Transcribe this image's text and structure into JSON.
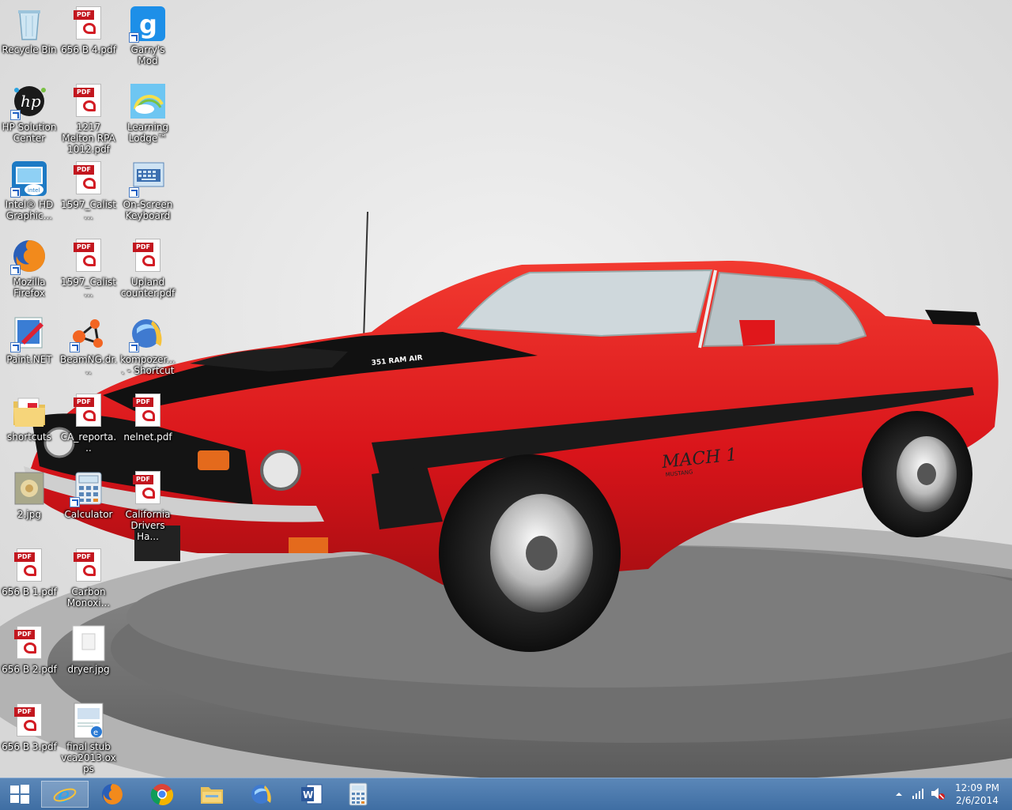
{
  "desktop": {
    "icons": [
      {
        "label": "Recycle Bin",
        "type": "recycle"
      },
      {
        "label": "656 B 4.pdf",
        "type": "pdf"
      },
      {
        "label": "Garry's Mod",
        "type": "app"
      },
      {
        "label": "HP Solution Center",
        "type": "app"
      },
      {
        "label": "1217 Melton RPA 1012.pdf",
        "type": "pdf"
      },
      {
        "label": "Learning Lodge™",
        "type": "app"
      },
      {
        "label": "Intel® HD Graphic...",
        "type": "app"
      },
      {
        "label": "1597_Calist...",
        "type": "pdf"
      },
      {
        "label": "On-Screen Keyboard",
        "type": "app"
      },
      {
        "label": "Mozilla Firefox",
        "type": "app"
      },
      {
        "label": "1597_Calist...",
        "type": "pdf"
      },
      {
        "label": "Upland counter.pdf",
        "type": "pdf"
      },
      {
        "label": "Paint.NET",
        "type": "app"
      },
      {
        "label": "BeamNG.dr...",
        "type": "app"
      },
      {
        "label": "kompozer.... - Shortcut",
        "type": "app"
      },
      {
        "label": "shortcuts",
        "type": "folder"
      },
      {
        "label": "CA_reporta...",
        "type": "pdf"
      },
      {
        "label": "nelnet.pdf",
        "type": "pdf"
      },
      {
        "label": "2.jpg",
        "type": "image"
      },
      {
        "label": "Calculator",
        "type": "app"
      },
      {
        "label": "California Drivers Ha...",
        "type": "pdf"
      },
      {
        "label": "656 B 1.pdf",
        "type": "pdf"
      },
      {
        "label": "Carbon Monoxi...",
        "type": "pdf"
      },
      {
        "label": "656 B 2.pdf",
        "type": "pdf"
      },
      {
        "label": "dryer.jpg",
        "type": "image"
      },
      {
        "label": "656 B 3.pdf",
        "type": "pdf"
      },
      {
        "label": "final stub vca2013.oxps",
        "type": "document"
      }
    ],
    "pdf_tag": "PDF",
    "wallpaper": {
      "car_color": "#e0171b",
      "hood_badge": "351 RAM AIR",
      "side_badge": "MACH 1",
      "side_sub": "MUSTANG"
    }
  },
  "taskbar": {
    "start_icon": "windows-logo-icon",
    "pinned": [
      {
        "name": "internet-explorer-icon",
        "active": true
      },
      {
        "name": "firefox-icon",
        "active": false
      },
      {
        "name": "chrome-icon",
        "active": false
      },
      {
        "name": "file-explorer-icon",
        "active": false
      },
      {
        "name": "kompozer-icon",
        "active": false
      },
      {
        "name": "word-icon",
        "active": false
      },
      {
        "name": "calculator-icon",
        "active": false
      }
    ],
    "clock": {
      "time": "12:09 PM",
      "date": "2/6/2014"
    }
  }
}
